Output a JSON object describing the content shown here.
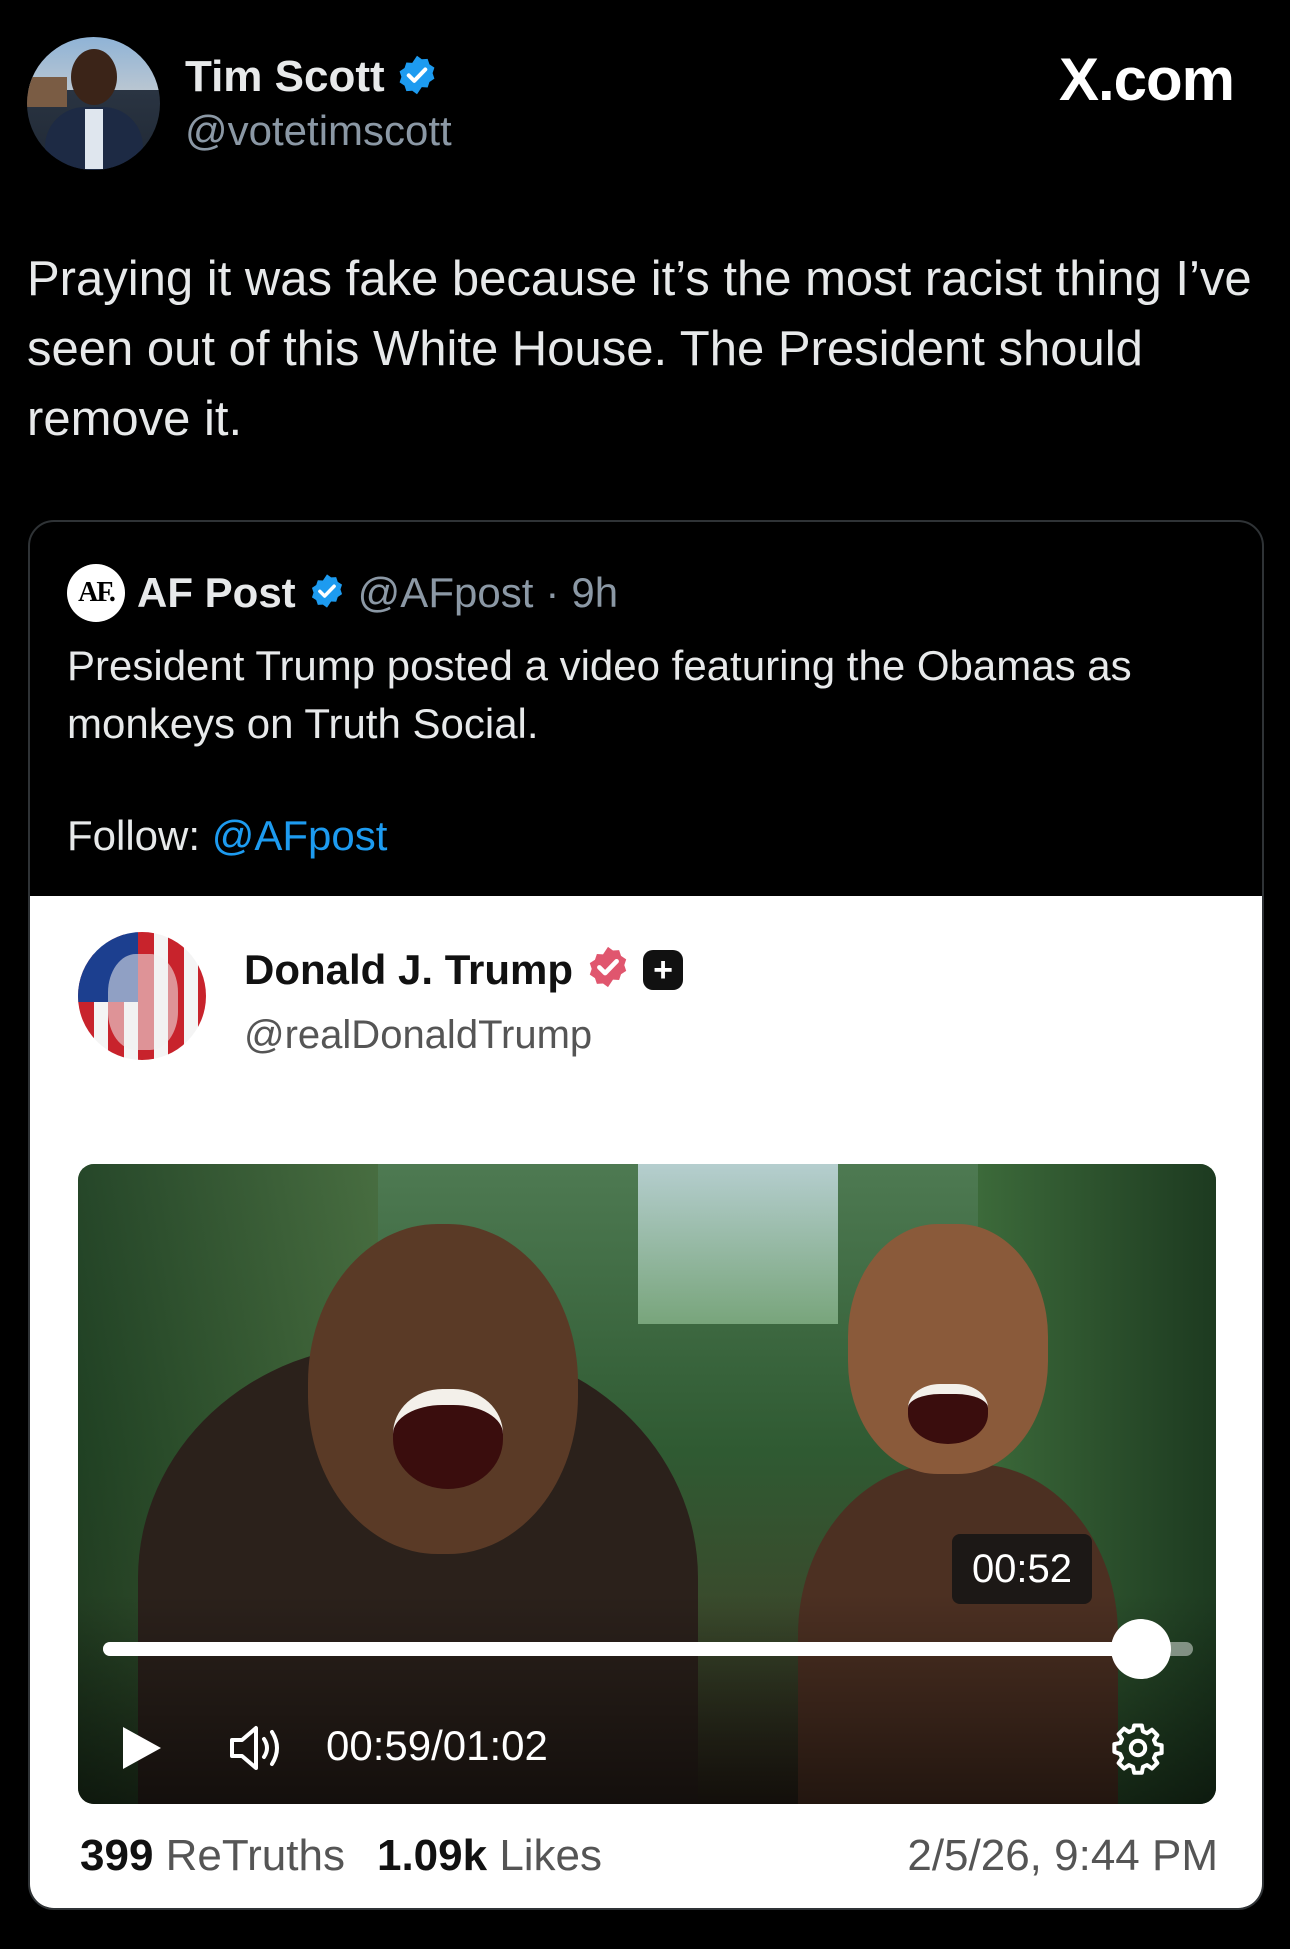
{
  "header": {
    "display_name": "Tim Scott",
    "handle": "@votetimscott",
    "source_site": "X.com"
  },
  "post": {
    "text": "Praying it was fake because it’s the most racist thing I’ve seen out of this White House. The President should remove it."
  },
  "quote": {
    "logo_text": "AF.",
    "display_name": "AF Post",
    "handle": "@AFpost",
    "separator": "·",
    "age": "9h",
    "text": "President Trump posted a video featuring the Obamas as monkeys on Truth Social.",
    "follow_label": "Follow:",
    "follow_link": "@AFpost"
  },
  "embed": {
    "display_name": "Donald J. Trump",
    "handle": "@realDonaldTrump",
    "video": {
      "hover_time": "00:52",
      "current_time": "00:59",
      "time_separator": "/",
      "duration": "01:02",
      "progress_fraction": 0.952
    },
    "stats": {
      "retruths_count": "399",
      "retruths_label": "ReTruths",
      "likes_count": "1.09k",
      "likes_label": "Likes",
      "date": "2/5/26, 9:44 PM"
    }
  },
  "colors": {
    "verified_blue": "#1d9bf0",
    "truth_badge_red": "#e0566e",
    "link": "#1d9bf0"
  },
  "icons": [
    "verified-badge-icon",
    "truth-verified-badge-icon",
    "plus-badge-icon",
    "play-icon",
    "volume-icon",
    "gear-icon",
    "picture-in-picture-icon"
  ]
}
